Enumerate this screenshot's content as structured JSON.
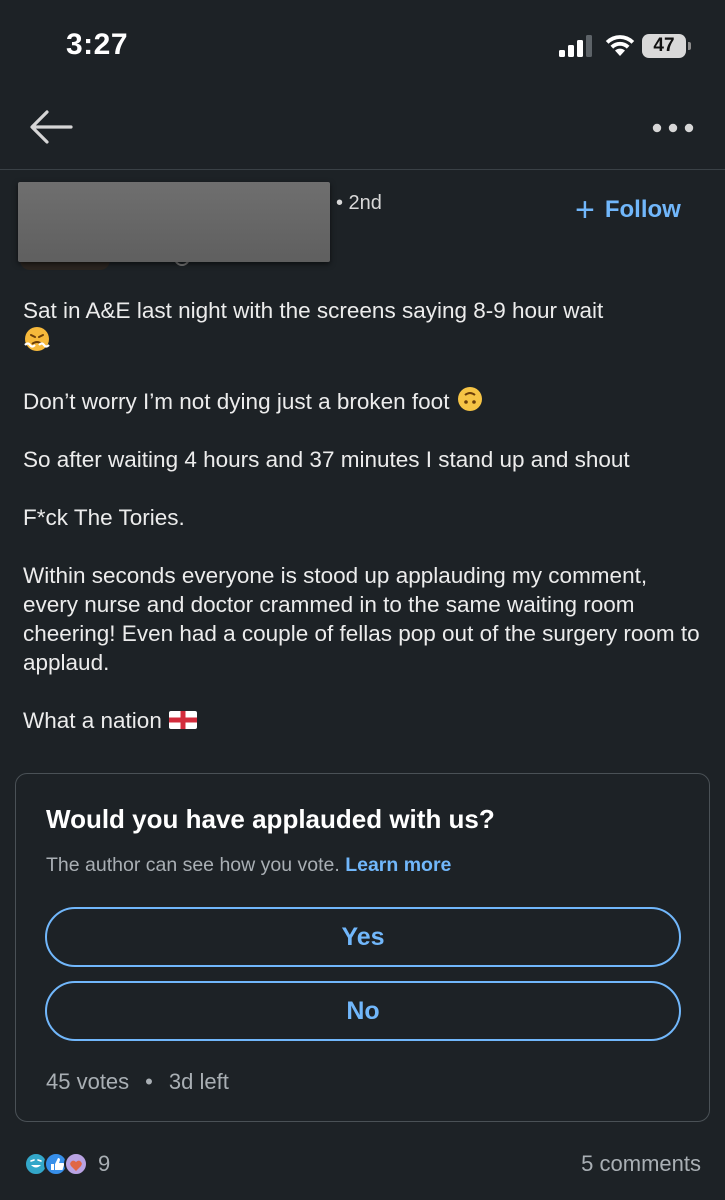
{
  "status": {
    "time": "3:27",
    "battery": "47"
  },
  "nav": {
    "back_icon": "arrow-left-icon",
    "more_icon": "more-dots-icon"
  },
  "author": {
    "degree": "• 2nd",
    "follow_label": "Follow",
    "follow_icon": "plus-icon"
  },
  "post": {
    "paragraphs": [
      "Sat in A&E last night with the screens saying 8-9 hour wait",
      "Don’t worry I’m not dying just a broken foot",
      "So after waiting 4 hours and 37 minutes I stand up and shout",
      "F*ck The Tories.",
      "Within seconds everyone is stood up applauding my comment, every nurse and doctor crammed in to the same waiting room cheering! Even had a couple of fellas pop out of the surgery room to applaud.",
      "What a nation"
    ],
    "emojis": [
      "steam-from-nose-face",
      "upside-down-face",
      "england-flag"
    ]
  },
  "poll": {
    "question": "Would you have applauded with us?",
    "note": "The author can see how you vote.",
    "learn_more": "Learn more",
    "options": [
      "Yes",
      "No"
    ],
    "votes": "45 votes",
    "separator": "•",
    "time_left": "3d left"
  },
  "social": {
    "reaction_icons": [
      "funny-icon",
      "like-icon",
      "support-icon"
    ],
    "reaction_count": "9",
    "comments": "5 comments"
  },
  "colors": {
    "background": "#1d2226",
    "accent": "#71b7fb",
    "text": "#ececec",
    "muted": "#a9afb4"
  }
}
